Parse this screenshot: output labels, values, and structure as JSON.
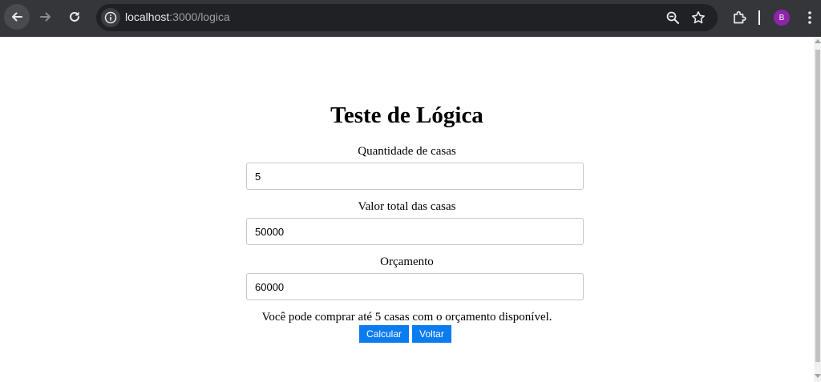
{
  "browser": {
    "url_host": "localhost",
    "url_path": ":3000/logica",
    "profile_initial": "B"
  },
  "page": {
    "title": "Teste de Lógica",
    "fields": [
      {
        "label": "Quantidade de casas",
        "value": "5"
      },
      {
        "label": "Valor total das casas",
        "value": "50000"
      },
      {
        "label": "Orçamento",
        "value": "60000"
      }
    ],
    "result": "Você pode comprar até 5 casas com o orçamento disponível.",
    "buttons": {
      "calculate": "Calcular",
      "back": "Voltar"
    }
  },
  "colors": {
    "chrome_bg": "#35363a",
    "omnibox_bg": "#202124",
    "button_bg": "#0b7bf0",
    "avatar_bg": "#8e24aa"
  },
  "icons": [
    "back-arrow-icon",
    "forward-arrow-icon",
    "reload-icon",
    "site-info-icon",
    "zoom-icon",
    "star-icon",
    "extensions-icon",
    "kebab-menu-icon"
  ]
}
